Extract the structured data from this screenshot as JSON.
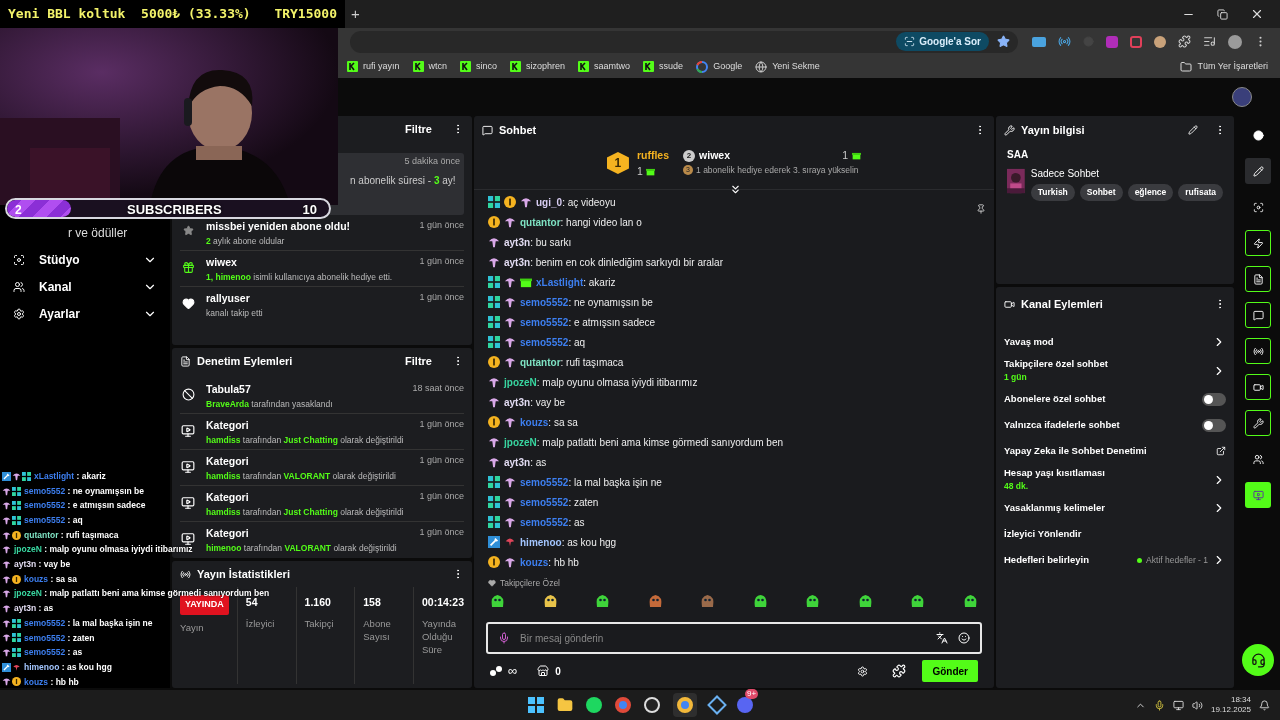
{
  "overlay": {
    "goal_text": "Yeni BBL koltuk  5000₺ (33.33%)",
    "goal_amount": "TRY15000",
    "sub_goal": {
      "current": "2",
      "label": "SUBSCRIBERS",
      "target": "10",
      "level": 0.2
    }
  },
  "browser": {
    "new_tab": "+",
    "ask_google": "Google'a Sor",
    "bookmarks": [
      {
        "kind": "kick",
        "label": "rufi yayın"
      },
      {
        "kind": "kick",
        "label": "wtcn"
      },
      {
        "kind": "kick",
        "label": "sinco"
      },
      {
        "kind": "kick",
        "label": "sizophren"
      },
      {
        "kind": "kick",
        "label": "saamtwo"
      },
      {
        "kind": "kick",
        "label": "ssude"
      },
      {
        "kind": "google",
        "label": "Google"
      },
      {
        "kind": "globe",
        "label": "Yeni Sekme"
      }
    ],
    "all_bookmarks": "Tüm Yer İşaretleri"
  },
  "sidebar": {
    "items": [
      {
        "kind": "cut",
        "label": "r ve ödüller"
      },
      {
        "kind": "studio",
        "label": "Stüdyo"
      },
      {
        "kind": "channel",
        "label": "Kanal"
      },
      {
        "kind": "settings",
        "label": "Ayarlar"
      }
    ]
  },
  "activity": {
    "filter": "Filtre",
    "items": [
      {
        "kind": "highlight",
        "time": "5 dakika önce",
        "detail": [
          {
            "text": "n abonelik süresi - ",
            "accent": false
          },
          {
            "text": "3",
            "accent": true
          },
          {
            "text": " ay!",
            "accent": false
          }
        ]
      },
      {
        "kind": "resub",
        "title": "missbei yeniden abone oldu!",
        "time": "1 gün önce",
        "detail": [
          {
            "text": "2",
            "accent": true
          },
          {
            "text": " aylık abone oldular",
            "accent": false
          }
        ]
      },
      {
        "kind": "gift",
        "title": "wiwex",
        "time": "1 gün önce",
        "detail": [
          {
            "text": "1, himenoo",
            "accent": true
          },
          {
            "text": " isimli kullanıcıya abonelik hediye etti.",
            "accent": false
          }
        ]
      },
      {
        "kind": "follow",
        "title": "rallyuser",
        "time": "1 gün önce",
        "detail": [
          {
            "text": "kanalı takip etti",
            "accent": false
          }
        ]
      }
    ]
  },
  "moderation": {
    "title": "Denetim Eylemleri",
    "filter": "Filtre",
    "items": [
      {
        "kind": "ban",
        "title": "Tabula57",
        "time": "18 saat önce",
        "detail": [
          {
            "text": "BraveArda",
            "accent": true
          },
          {
            "text": " tarafından yasaklandı",
            "accent": false
          }
        ]
      },
      {
        "kind": "category",
        "title": "Kategori",
        "time": "1 gün önce",
        "detail": [
          {
            "text": "hamdiss",
            "accent": true
          },
          {
            "text": " tarafından ",
            "accent": false
          },
          {
            "text": "Just Chatting",
            "accent": true
          },
          {
            "text": " olarak değiştirildi",
            "accent": false
          }
        ]
      },
      {
        "kind": "category",
        "title": "Kategori",
        "time": "1 gün önce",
        "detail": [
          {
            "text": "hamdiss",
            "accent": true
          },
          {
            "text": " tarafından ",
            "accent": false
          },
          {
            "text": "VALORANT",
            "accent": true
          },
          {
            "text": " olarak değiştirildi",
            "accent": false
          }
        ]
      },
      {
        "kind": "category",
        "title": "Kategori",
        "time": "1 gün önce",
        "detail": [
          {
            "text": "hamdiss",
            "accent": true
          },
          {
            "text": " tarafından ",
            "accent": false
          },
          {
            "text": "Just Chatting",
            "accent": true
          },
          {
            "text": " olarak değiştirildi",
            "accent": false
          }
        ]
      },
      {
        "kind": "category",
        "title": "Kategori",
        "time": "1 gün önce",
        "detail": [
          {
            "text": "himenoo",
            "accent": true
          },
          {
            "text": " tarafından ",
            "accent": false
          },
          {
            "text": "VALORANT",
            "accent": true
          },
          {
            "text": " olarak değiştirildi",
            "accent": false
          }
        ]
      }
    ]
  },
  "stats": {
    "title": "Yayın İstatistikleri",
    "cells": [
      {
        "kind": "status",
        "value": "YAYINDA",
        "label": "Yayın"
      },
      {
        "kind": "number",
        "value": "54",
        "label": "İzleyici"
      },
      {
        "kind": "number",
        "value": "1.160",
        "label": "Takipçi"
      },
      {
        "kind": "number",
        "value": "158",
        "label": "Abone Sayısı"
      },
      {
        "kind": "number",
        "value": "00:14:23",
        "label": "Yayında Olduğu Süre"
      }
    ]
  },
  "chat": {
    "title": "Sohbet",
    "leader": {
      "rank": "1",
      "name": "ruffles",
      "count": "1"
    },
    "runner": {
      "rank": "2",
      "name": "wiwex",
      "count": "1",
      "hint_rank": "3",
      "hint": "1 abonelik hediye ederek 3. sıraya yükselin"
    },
    "messages": [
      {
        "user": "ugi_0",
        "color": "#d8cdf2",
        "text": ": aç videoyu",
        "badges": [
          {
            "kind": "sub"
          },
          {
            "kind": "gifter"
          },
          {
            "kind": "og"
          }
        ]
      },
      {
        "user": "qutantor",
        "color": "#7fe3c4",
        "text": ": hangi video lan o",
        "badges": [
          {
            "kind": "gifter"
          },
          {
            "kind": "og"
          }
        ]
      },
      {
        "user": "ayt3n",
        "color": "#e2dcf2",
        "text": ": bu sarkı",
        "badges": [
          {
            "kind": "og"
          }
        ]
      },
      {
        "user": "ayt3n",
        "color": "#e2dcf2",
        "text": ": benim en cok dinlediğim sarkıydı bir aralar",
        "badges": [
          {
            "kind": "og"
          }
        ]
      },
      {
        "user": "xLastlight",
        "color": "#3d7ff0",
        "text": ": akariz",
        "badges": [
          {
            "kind": "sub"
          },
          {
            "kind": "og"
          },
          {
            "kind": "gift"
          }
        ]
      },
      {
        "user": "semo5552",
        "color": "#3d7ff0",
        "text": ": ne oynamışsın be",
        "badges": [
          {
            "kind": "sub"
          },
          {
            "kind": "og"
          }
        ]
      },
      {
        "user": "semo5552",
        "color": "#3d7ff0",
        "text": ": e atmışsın sadece",
        "badges": [
          {
            "kind": "sub"
          },
          {
            "kind": "og"
          }
        ]
      },
      {
        "user": "semo5552",
        "color": "#3d7ff0",
        "text": ": aq",
        "badges": [
          {
            "kind": "sub"
          },
          {
            "kind": "og"
          }
        ]
      },
      {
        "user": "qutantor",
        "color": "#7fe3c4",
        "text": ": rufi taşımaca",
        "badges": [
          {
            "kind": "gifter"
          },
          {
            "kind": "og"
          }
        ]
      },
      {
        "user": "jpozeN",
        "color": "#38d6a0",
        "text": ": malp oyunu olmasa iyiydi itibarımız",
        "badges": [
          {
            "kind": "og"
          }
        ]
      },
      {
        "user": "ayt3n",
        "color": "#e2dcf2",
        "text": ": vay be",
        "badges": [
          {
            "kind": "og"
          }
        ]
      },
      {
        "user": "kouzs",
        "color": "#3d7ff0",
        "text": ": sa sa",
        "badges": [
          {
            "kind": "gifter"
          },
          {
            "kind": "og"
          }
        ]
      },
      {
        "user": "jpozeN",
        "color": "#38d6a0",
        "text": ": malp patlattı beni ama kimse görmedi sanıyordum ben",
        "badges": [
          {
            "kind": "og"
          }
        ]
      },
      {
        "user": "ayt3n",
        "color": "#e2dcf2",
        "text": ": as",
        "badges": [
          {
            "kind": "og"
          }
        ]
      },
      {
        "user": "semo5552",
        "color": "#3d7ff0",
        "text": ": la mal başka işin ne",
        "badges": [
          {
            "kind": "sub"
          },
          {
            "kind": "og"
          }
        ]
      },
      {
        "user": "semo5552",
        "color": "#3d7ff0",
        "text": ": zaten",
        "badges": [
          {
            "kind": "sub"
          },
          {
            "kind": "og"
          }
        ]
      },
      {
        "user": "semo5552",
        "color": "#3d7ff0",
        "text": ": as",
        "badges": [
          {
            "kind": "sub"
          },
          {
            "kind": "og"
          }
        ]
      },
      {
        "user": "himenoo",
        "color": "#a3c6ff",
        "text": ": as kou hgg",
        "badges": [
          {
            "kind": "mod"
          },
          {
            "kind": "staff"
          }
        ]
      },
      {
        "user": "kouzs",
        "color": "#3d7ff0",
        "text": ": hb hb",
        "badges": [
          {
            "kind": "gifter"
          },
          {
            "kind": "og"
          }
        ]
      }
    ],
    "followers_only": "Takipçilere Özel",
    "placeholder": "Bir mesaj gönderin",
    "infinity": "∞",
    "points": "0",
    "send": "Gönder"
  },
  "overlay_chat": [
    {
      "user": "xLastlight",
      "color": "#3d7ff0",
      "text": " : akariz",
      "badges": [
        {
          "kind": "mod"
        },
        {
          "kind": "og"
        },
        {
          "kind": "sub"
        }
      ]
    },
    {
      "user": "semo5552",
      "color": "#3d7ff0",
      "text": " : ne oynamışsın be",
      "badges": [
        {
          "kind": "og"
        },
        {
          "kind": "sub"
        }
      ]
    },
    {
      "user": "semo5552",
      "color": "#3d7ff0",
      "text": " : e atmışsın sadece",
      "badges": [
        {
          "kind": "og"
        },
        {
          "kind": "sub"
        }
      ]
    },
    {
      "user": "semo5552",
      "color": "#3d7ff0",
      "text": " : aq",
      "badges": [
        {
          "kind": "og"
        },
        {
          "kind": "sub"
        }
      ]
    },
    {
      "user": "qutantor",
      "color": "#7fe3c4",
      "text": " : rufi taşımaca",
      "badges": [
        {
          "kind": "og"
        },
        {
          "kind": "gifter"
        }
      ]
    },
    {
      "user": "jpozeN",
      "color": "#38d6a0",
      "text": " : malp oyunu olmasa iyiydi itibarımız",
      "badges": [
        {
          "kind": "og"
        }
      ]
    },
    {
      "user": "ayt3n",
      "color": "#e2dcf2",
      "text": " : vay be",
      "badges": [
        {
          "kind": "og"
        }
      ]
    },
    {
      "user": "kouzs",
      "color": "#3d7ff0",
      "text": " : sa sa",
      "badges": [
        {
          "kind": "og"
        },
        {
          "kind": "gifter"
        }
      ]
    },
    {
      "user": "jpozeN",
      "color": "#38d6a0",
      "text": " : malp patlattı beni ama kimse görmedi sanıyordum ben",
      "badges": [
        {
          "kind": "og"
        }
      ]
    },
    {
      "user": "ayt3n",
      "color": "#e2dcf2",
      "text": " : as",
      "badges": [
        {
          "kind": "og"
        }
      ]
    },
    {
      "user": "semo5552",
      "color": "#3d7ff0",
      "text": " : la mal başka işin ne",
      "badges": [
        {
          "kind": "og"
        },
        {
          "kind": "sub"
        }
      ]
    },
    {
      "user": "semo5552",
      "color": "#3d7ff0",
      "text": " : zaten",
      "badges": [
        {
          "kind": "og"
        },
        {
          "kind": "sub"
        }
      ]
    },
    {
      "user": "semo5552",
      "color": "#3d7ff0",
      "text": " : as",
      "badges": [
        {
          "kind": "og"
        },
        {
          "kind": "sub"
        }
      ]
    },
    {
      "user": "himenoo",
      "color": "#a3c6ff",
      "text": " : as kou hgg",
      "badges": [
        {
          "kind": "mod"
        },
        {
          "kind": "staff"
        }
      ]
    },
    {
      "user": "kouzs",
      "color": "#3d7ff0",
      "text": " : hb hb",
      "badges": [
        {
          "kind": "og"
        },
        {
          "kind": "gifter"
        }
      ]
    }
  ],
  "stream_info": {
    "title": "Yayın bilgisi",
    "stream_title": "SAA",
    "category": "Sadece Sohbet",
    "tags": [
      "Turkish",
      "Sohbet",
      "eğlence",
      "rufisata"
    ]
  },
  "channel_actions": {
    "title": "Kanal Eylemleri",
    "items": [
      {
        "kind": "link",
        "label": "Yavaş mod"
      },
      {
        "kind": "link",
        "label": "Takipçilere özel sohbet",
        "sub": "1 gün"
      },
      {
        "kind": "toggle",
        "label": "Abonelere özel sohbet",
        "on": false
      },
      {
        "kind": "toggle",
        "label": "Yalnızca ifadelerle sohbet",
        "on": false
      },
      {
        "kind": "external",
        "label": "Yapay Zeka ile Sohbet Denetimi"
      },
      {
        "kind": "link",
        "label": "Hesap yaşı kısıtlaması",
        "sub": "48 dk."
      },
      {
        "kind": "link",
        "label": "Yasaklanmış kelimeler"
      },
      {
        "kind": "plain",
        "label": "İzleyici Yönlendir"
      },
      {
        "kind": "link",
        "label": "Hedefleri belirleyin",
        "status": "Aktif hedefler - 1"
      }
    ]
  },
  "taskbar": {
    "discord_badge": "9+",
    "time": "18:34",
    "date": "19.12.2025"
  }
}
